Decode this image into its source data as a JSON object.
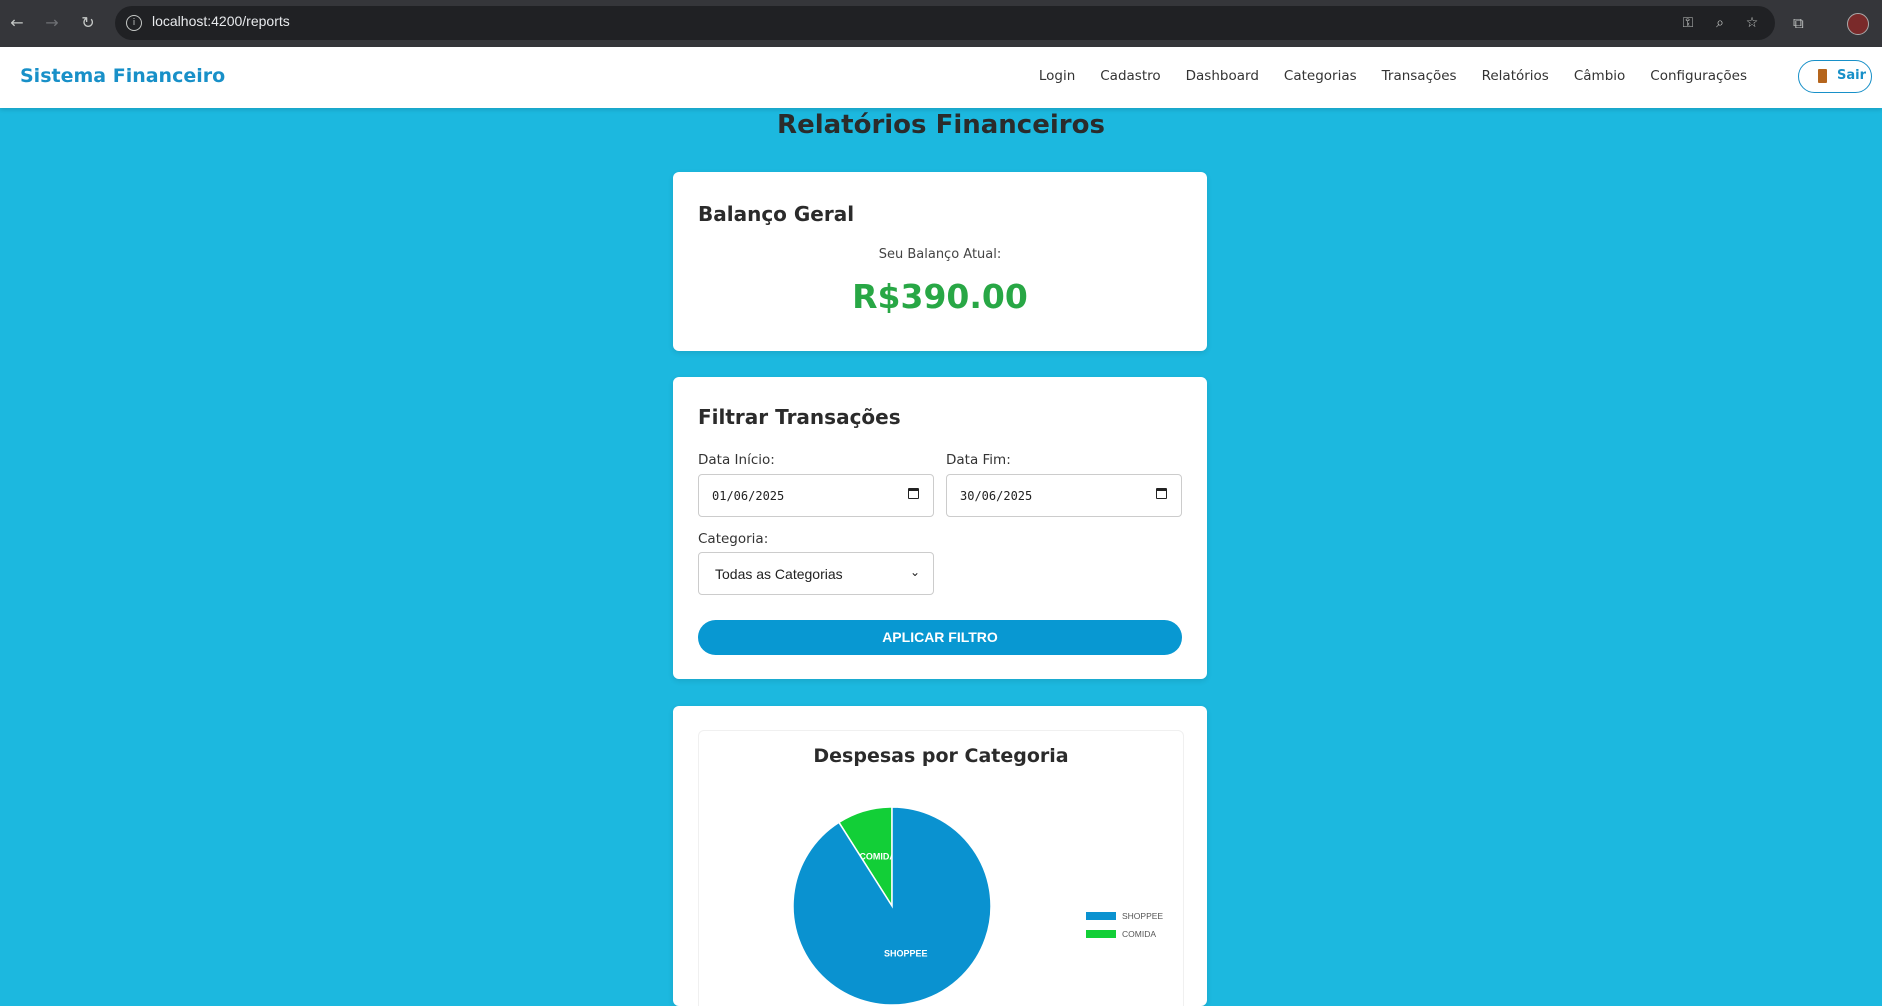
{
  "browser": {
    "url": "localhost:4200/reports",
    "icons": [
      "back-icon",
      "forward-icon",
      "reload-icon",
      "info-icon",
      "key-icon",
      "zoom-icon",
      "star-icon",
      "extensions-icon",
      "avatar"
    ]
  },
  "header": {
    "brand": "Sistema Financeiro",
    "nav": [
      "Login",
      "Cadastro",
      "Dashboard",
      "Categorias",
      "Transações",
      "Relatórios",
      "Câmbio",
      "Configurações"
    ],
    "logout_label": "Sair",
    "accent_color": "#1890c8"
  },
  "page": {
    "title": "Relatórios Financeiros",
    "background_color": "#1cb8df"
  },
  "balance": {
    "heading": "Balanço Geral",
    "label": "Seu Balanço Atual:",
    "value": "R$390.00",
    "value_color": "#28a745"
  },
  "filter": {
    "heading": "Filtrar Transações",
    "start_label": "Data Início:",
    "start_value": "01/06/2025",
    "end_label": "Data Fim:",
    "end_value": "30/06/2025",
    "category_label": "Categoria:",
    "category_value": "Todas as Categorias",
    "apply_label": "APLICAR FILTRO"
  },
  "chart_data": {
    "type": "pie",
    "title": "Despesas por Categoria",
    "categories": [
      "SHOPPEE",
      "COMIDA"
    ],
    "values": [
      91,
      9
    ],
    "colors": [
      "#0a92d0",
      "#12cf37"
    ],
    "legend": "right"
  }
}
